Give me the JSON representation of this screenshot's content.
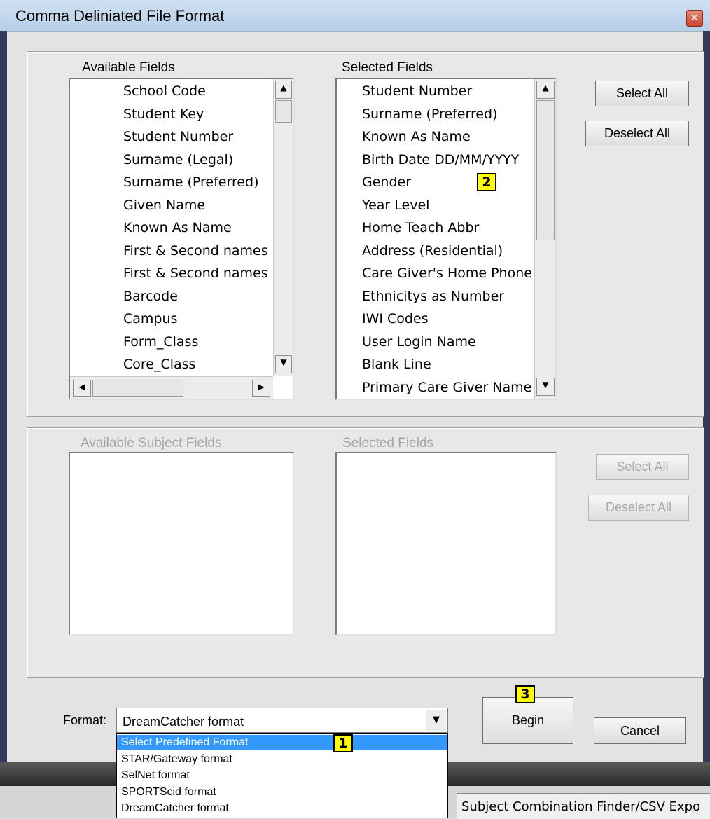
{
  "window": {
    "title": "Comma Deliniated File Format",
    "close_glyph": "×"
  },
  "fields_panel": {
    "available_label": "Available Fields",
    "selected_label": "Selected Fields",
    "available_items": [
      "School Code",
      "Student Key",
      "Student Number",
      "Surname (Legal)",
      "Surname (Preferred)",
      "Given Name",
      "Known As Name",
      "First & Second names",
      "First & Second names",
      "Barcode",
      "Campus",
      "Form_Class",
      "Core_Class"
    ],
    "selected_items": [
      "Student Number",
      "Surname (Preferred)",
      "Known As Name",
      "Birth Date DD/MM/YYYY",
      "Gender",
      "Year Level",
      "Home Teach Abbr",
      "Address (Residential)",
      "Care Giver's Home Phone",
      "Ethnicitys as Number",
      "IWI Codes",
      "User Login Name",
      "Blank Line",
      "Primary Care Giver Name"
    ],
    "select_all_label": "Select All",
    "deselect_all_label": "Deselect All"
  },
  "subject_panel": {
    "available_label": "Available Subject Fields",
    "selected_label": "Selected Fields",
    "select_all_label": "Select All",
    "deselect_all_label": "Deselect All"
  },
  "format": {
    "label": "Format:",
    "value": "DreamCatcher format",
    "options": [
      "Select Predefined Format",
      "STAR/Gateway format",
      "SelNet format",
      "SPORTScid format",
      "DreamCatcher format"
    ],
    "highlighted_option": "Select Predefined Format"
  },
  "actions": {
    "begin_label": "Begin",
    "cancel_label": "Cancel"
  },
  "badges": {
    "one": "1",
    "two": "2",
    "three": "3"
  },
  "status": {
    "text": "Subject Combination Finder/CSV Expo"
  },
  "icons": {
    "scroll_up": "▲",
    "scroll_down": "▼",
    "scroll_left": "◀",
    "scroll_right": "▶",
    "dropdown": "▼"
  }
}
